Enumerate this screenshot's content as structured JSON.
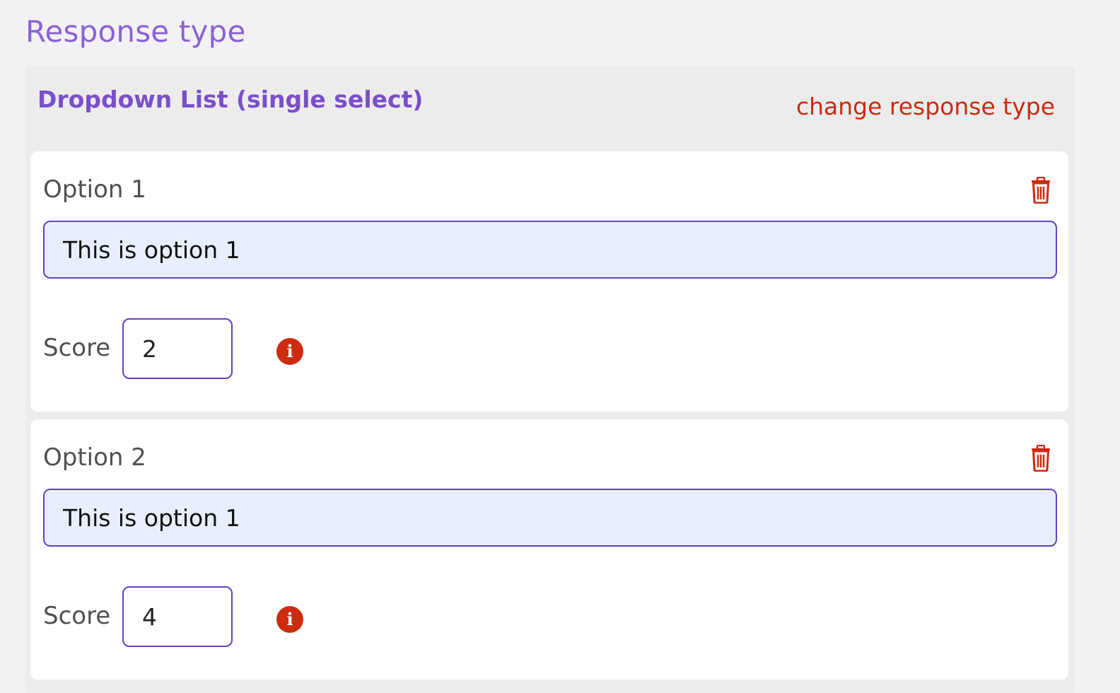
{
  "section": {
    "title": "Response type"
  },
  "response": {
    "type_name": "Dropdown List (single select)",
    "change_link": "change response type"
  },
  "options": [
    {
      "label": "Option 1",
      "value": "This is option 1",
      "score_label": "Score",
      "score": "2",
      "info_icon": "i"
    },
    {
      "label": "Option 2",
      "value": "This is option 1",
      "score_label": "Score",
      "score": "4",
      "info_icon": "i"
    }
  ],
  "icons": {
    "delete": "trash-icon",
    "info": "info-icon"
  },
  "colors": {
    "title_purple": "#8a63d2",
    "type_purple": "#7a4fc9",
    "accent_red": "#cc2b10",
    "input_border": "#6541c2",
    "input_fill": "#e8effc"
  }
}
